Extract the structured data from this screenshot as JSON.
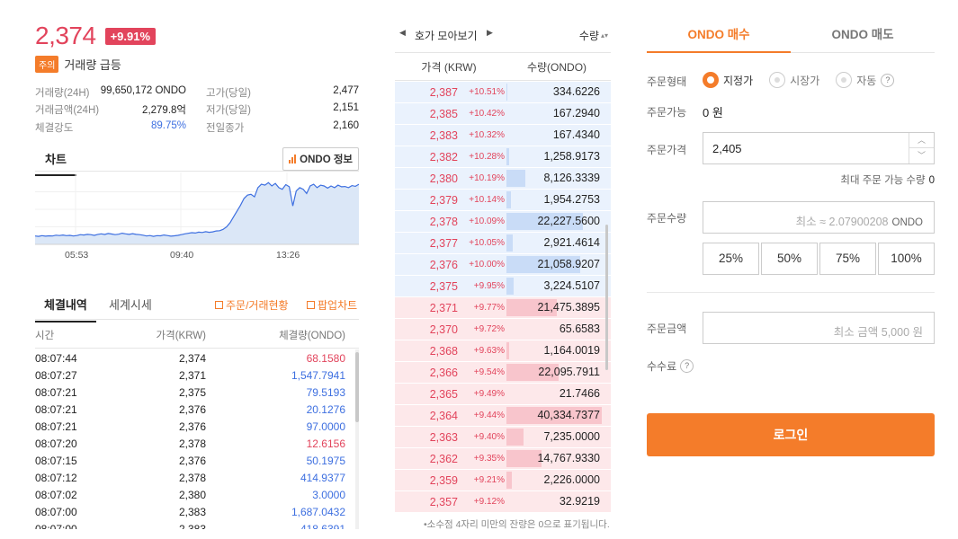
{
  "ticker": {
    "price": "2,374",
    "change": "+9.91%",
    "warn_tag": "주의",
    "warn_text": "거래량 급등",
    "stats": [
      {
        "l1": "거래량(24H)",
        "v1": "99,650,172 ONDO",
        "l2": "고가(당일)",
        "v2": "2,477"
      },
      {
        "l1": "거래금액(24H)",
        "v1": "2,279.8억",
        "l2": "저가(당일)",
        "v2": "2,151"
      },
      {
        "l1": "체결강도",
        "v1": "89.75%",
        "l2": "전일종가",
        "v2": "2,160"
      }
    ]
  },
  "chart_section": {
    "tab": "차트",
    "info_button": "ONDO 정보",
    "x_ticks": [
      "05:53",
      "09:40",
      "13:26"
    ]
  },
  "chart_data": {
    "type": "area",
    "x_ticks": [
      "05:53",
      "09:40",
      "13:26"
    ],
    "ylim": [
      2100,
      2520
    ],
    "values": [
      2150,
      2148,
      2152,
      2149,
      2151,
      2150,
      2155,
      2153,
      2156,
      2152,
      2154,
      2150,
      2153,
      2158,
      2156,
      2160,
      2158,
      2154,
      2160,
      2163,
      2159,
      2165,
      2162,
      2158,
      2161,
      2167,
      2163,
      2160,
      2164,
      2160,
      2158,
      2155,
      2150,
      2153,
      2148,
      2152,
      2151,
      2156,
      2153,
      2149,
      2151,
      2154,
      2158,
      2163,
      2166,
      2170,
      2168,
      2173,
      2171,
      2176,
      2172,
      2175,
      2180,
      2182,
      2190,
      2205,
      2230,
      2265,
      2300,
      2335,
      2375,
      2395,
      2400,
      2385,
      2440,
      2460,
      2455,
      2470,
      2450,
      2465,
      2440,
      2430,
      2458,
      2445,
      2330,
      2420,
      2440,
      2430,
      2405,
      2450,
      2460,
      2440,
      2455,
      2450,
      2437,
      2450,
      2440,
      2455,
      2445,
      2447,
      2440,
      2452,
      2448,
      2460
    ]
  },
  "trades": {
    "tab_active": "체결내역",
    "tab_other": "세계시세",
    "link1": "주문/거래현황",
    "link2": "팝업차트",
    "headers": {
      "time": "시간",
      "price": "가격(KRW)",
      "volume": "체결량(ONDO)"
    },
    "rows": [
      {
        "time": "08:07:44",
        "price": "2,374",
        "volume": "68.1580",
        "side": "up"
      },
      {
        "time": "08:07:27",
        "price": "2,371",
        "volume": "1,547.7941",
        "side": "down"
      },
      {
        "time": "08:07:21",
        "price": "2,375",
        "volume": "79.5193",
        "side": "down"
      },
      {
        "time": "08:07:21",
        "price": "2,376",
        "volume": "20.1276",
        "side": "down"
      },
      {
        "time": "08:07:21",
        "price": "2,376",
        "volume": "97.0000",
        "side": "down"
      },
      {
        "time": "08:07:20",
        "price": "2,378",
        "volume": "12.6156",
        "side": "up"
      },
      {
        "time": "08:07:15",
        "price": "2,376",
        "volume": "50.1975",
        "side": "down"
      },
      {
        "time": "08:07:12",
        "price": "2,378",
        "volume": "414.9377",
        "side": "down"
      },
      {
        "time": "08:07:02",
        "price": "2,380",
        "volume": "3.0000",
        "side": "down"
      },
      {
        "time": "08:07:00",
        "price": "2,383",
        "volume": "1,687.0432",
        "side": "down"
      },
      {
        "time": "08:07:00",
        "price": "2,383",
        "volume": "418.6391",
        "side": "down"
      }
    ]
  },
  "orderbook": {
    "title": "호가 모아보기",
    "sort_label": "수량",
    "col_price": "가격 (KRW)",
    "col_qty": "수량(ONDO)",
    "note": "•소수점 4자리 미만의 잔량은 0으로 표기됩니다.",
    "asks": [
      {
        "price": "2,387",
        "pct": "+10.51%",
        "qty": "334.6226",
        "ratio": 0.01
      },
      {
        "price": "2,385",
        "pct": "+10.42%",
        "qty": "167.2940",
        "ratio": 0.0
      },
      {
        "price": "2,383",
        "pct": "+10.32%",
        "qty": "167.4340",
        "ratio": 0.0
      },
      {
        "price": "2,382",
        "pct": "+10.28%",
        "qty": "1,258.9173",
        "ratio": 0.03
      },
      {
        "price": "2,380",
        "pct": "+10.19%",
        "qty": "8,126.3339",
        "ratio": 0.2
      },
      {
        "price": "2,379",
        "pct": "+10.14%",
        "qty": "1,954.2753",
        "ratio": 0.05
      },
      {
        "price": "2,378",
        "pct": "+10.09%",
        "qty": "22,227.5600",
        "ratio": 0.8
      },
      {
        "price": "2,377",
        "pct": "+10.05%",
        "qty": "2,921.4614",
        "ratio": 0.07
      },
      {
        "price": "2,376",
        "pct": "+10.00%",
        "qty": "21,058.9207",
        "ratio": 0.77
      },
      {
        "price": "2,375",
        "pct": "+9.95%",
        "qty": "3,224.5107",
        "ratio": 0.08
      }
    ],
    "bids": [
      {
        "price": "2,371",
        "pct": "+9.77%",
        "qty": "21,475.3895",
        "ratio": 0.53
      },
      {
        "price": "2,370",
        "pct": "+9.72%",
        "qty": "65.6583",
        "ratio": 0.0
      },
      {
        "price": "2,368",
        "pct": "+9.63%",
        "qty": "1,164.0019",
        "ratio": 0.03
      },
      {
        "price": "2,366",
        "pct": "+9.54%",
        "qty": "22,095.7911",
        "ratio": 0.55
      },
      {
        "price": "2,365",
        "pct": "+9.49%",
        "qty": "21.7466",
        "ratio": 0.0
      },
      {
        "price": "2,364",
        "pct": "+9.44%",
        "qty": "40,334.7377",
        "ratio": 1.0
      },
      {
        "price": "2,363",
        "pct": "+9.40%",
        "qty": "7,235.0000",
        "ratio": 0.18
      },
      {
        "price": "2,362",
        "pct": "+9.35%",
        "qty": "14,767.9330",
        "ratio": 0.37
      },
      {
        "price": "2,359",
        "pct": "+9.21%",
        "qty": "2,226.0000",
        "ratio": 0.06
      },
      {
        "price": "2,357",
        "pct": "+9.12%",
        "qty": "32.9219",
        "ratio": 0.0
      }
    ]
  },
  "order_form": {
    "tab_buy": "ONDO 매수",
    "tab_sell": "ONDO 매도",
    "type_label": "주문형태",
    "type_options": [
      "지정가",
      "시장가",
      "자동"
    ],
    "avail_label": "주문가능",
    "avail_value": "0 원",
    "price_label": "주문가격",
    "price_value": "2,405",
    "max_label": "최대 주문 가능 수량",
    "max_value": "0",
    "qty_label": "주문수량",
    "qty_placeholder": "최소 ≈ 2.07900208",
    "qty_unit": "ONDO",
    "pct_buttons": [
      "25%",
      "50%",
      "75%",
      "100%"
    ],
    "amount_label": "주문금액",
    "amount_placeholder": "최소 금액 5,000 원",
    "fee_label": "수수료",
    "login_button": "로그인"
  },
  "colors": {
    "up": "#e2445c",
    "down": "#3d6fe0",
    "accent": "#f47c2a"
  }
}
